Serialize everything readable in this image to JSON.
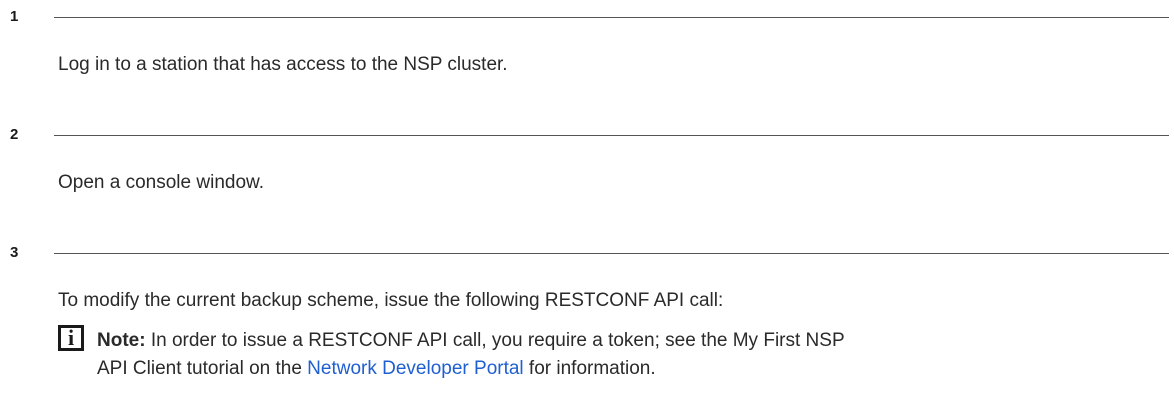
{
  "steps": [
    {
      "number": "1",
      "text": "Log in to a station that has access to the NSP cluster."
    },
    {
      "number": "2",
      "text": "Open a console window."
    },
    {
      "number": "3",
      "text": "To modify the current backup scheme, issue the following RESTCONF API call:"
    }
  ],
  "note": {
    "icon": "info-icon",
    "icon_glyph": "i",
    "label": "Note:",
    "line1": " In order to issue a RESTCONF API call, you require a token; see the My First NSP",
    "line2_before": "API Client tutorial on the ",
    "link_text": "Network Developer Portal",
    "line2_after": " for information."
  },
  "colors": {
    "link": "#1f5fd1",
    "rule": "#555555",
    "text": "#2a2a2a"
  }
}
